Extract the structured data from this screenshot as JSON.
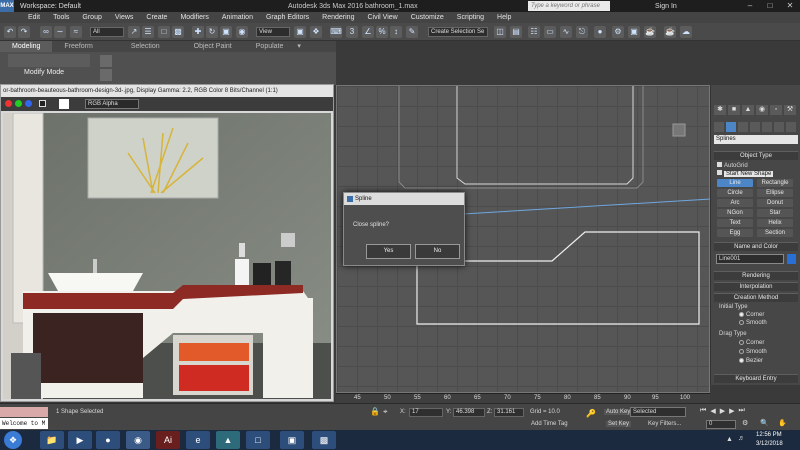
{
  "titlebar": {
    "logo": "MAX",
    "workspace": "Workspace: Default",
    "title": "Autodesk 3ds Max 2016     bathroom_1.max",
    "search_placeholder": "Type a keyword or phrase",
    "signin": "Sign In"
  },
  "menu": [
    "Edit",
    "Tools",
    "Group",
    "Views",
    "Create",
    "Modifiers",
    "Animation",
    "Graph Editors",
    "Rendering",
    "Civil View",
    "Customize",
    "Scripting",
    "Help"
  ],
  "toolbar": {
    "selection_filter": "All",
    "ref_coord": "View",
    "named_selection": "Create Selection Se"
  },
  "ribbon": {
    "tabs": [
      "Modeling",
      "Freeform",
      "Selection",
      "Object Paint",
      "Populate"
    ],
    "modify_mode": "Modify Mode"
  },
  "image_window": {
    "title": "or-bathroom-beauteous-bathroom-design-3d-.jpg, Display Gamma: 2.2, RGB Color 8 Bits/Channel (1:1)",
    "channel": "RGB Alpha"
  },
  "dialog": {
    "title": "Spline",
    "question": "Close spline?",
    "yes": "Yes",
    "no": "No"
  },
  "command_panel": {
    "category": "Splines",
    "object_type": "Object Type",
    "autogrid": "AutoGrid",
    "start_new_shape": "Start New Shape",
    "buttons": [
      "Line",
      "Rectangle",
      "Circle",
      "Ellipse",
      "Arc",
      "Donut",
      "NGon",
      "Star",
      "Text",
      "Helix",
      "Egg",
      "Section"
    ],
    "name_and_color": "Name and Color",
    "object_name": "Line001",
    "rendering": "Rendering",
    "interpolation": "Interpolation",
    "creation_method": "Creation Method",
    "initial_type": "Initial Type",
    "initial_options": [
      "Corner",
      "Smooth"
    ],
    "drag_type": "Drag Type",
    "drag_options": [
      "Corner",
      "Smooth",
      "Bezier"
    ],
    "keyboard_entry": "Keyboard Entry",
    "accent": "#4c86c6",
    "object_color": "#2a6fd6"
  },
  "timeline": {
    "ticks": [
      "45",
      "50",
      "55",
      "60",
      "65",
      "70",
      "75",
      "80",
      "85",
      "90",
      "95",
      "100"
    ]
  },
  "status": {
    "maxscript": "Welcome to M",
    "selection": "1 Shape Selected",
    "x_label": "X:",
    "x_value": "17",
    "y_label": "Y:",
    "y_value": "46.398",
    "z_label": "Z:",
    "z_value": "31.161",
    "grid": "Grid = 10.0",
    "add_time_tag": "Add Time Tag",
    "auto_key": "Auto Key",
    "key_mode": "Selected",
    "set_key": "Set Key",
    "key_filters": "Key Filters...",
    "frame": "0"
  },
  "taskbar": {
    "time": "12:56 PM",
    "date": "3/12/2018"
  }
}
